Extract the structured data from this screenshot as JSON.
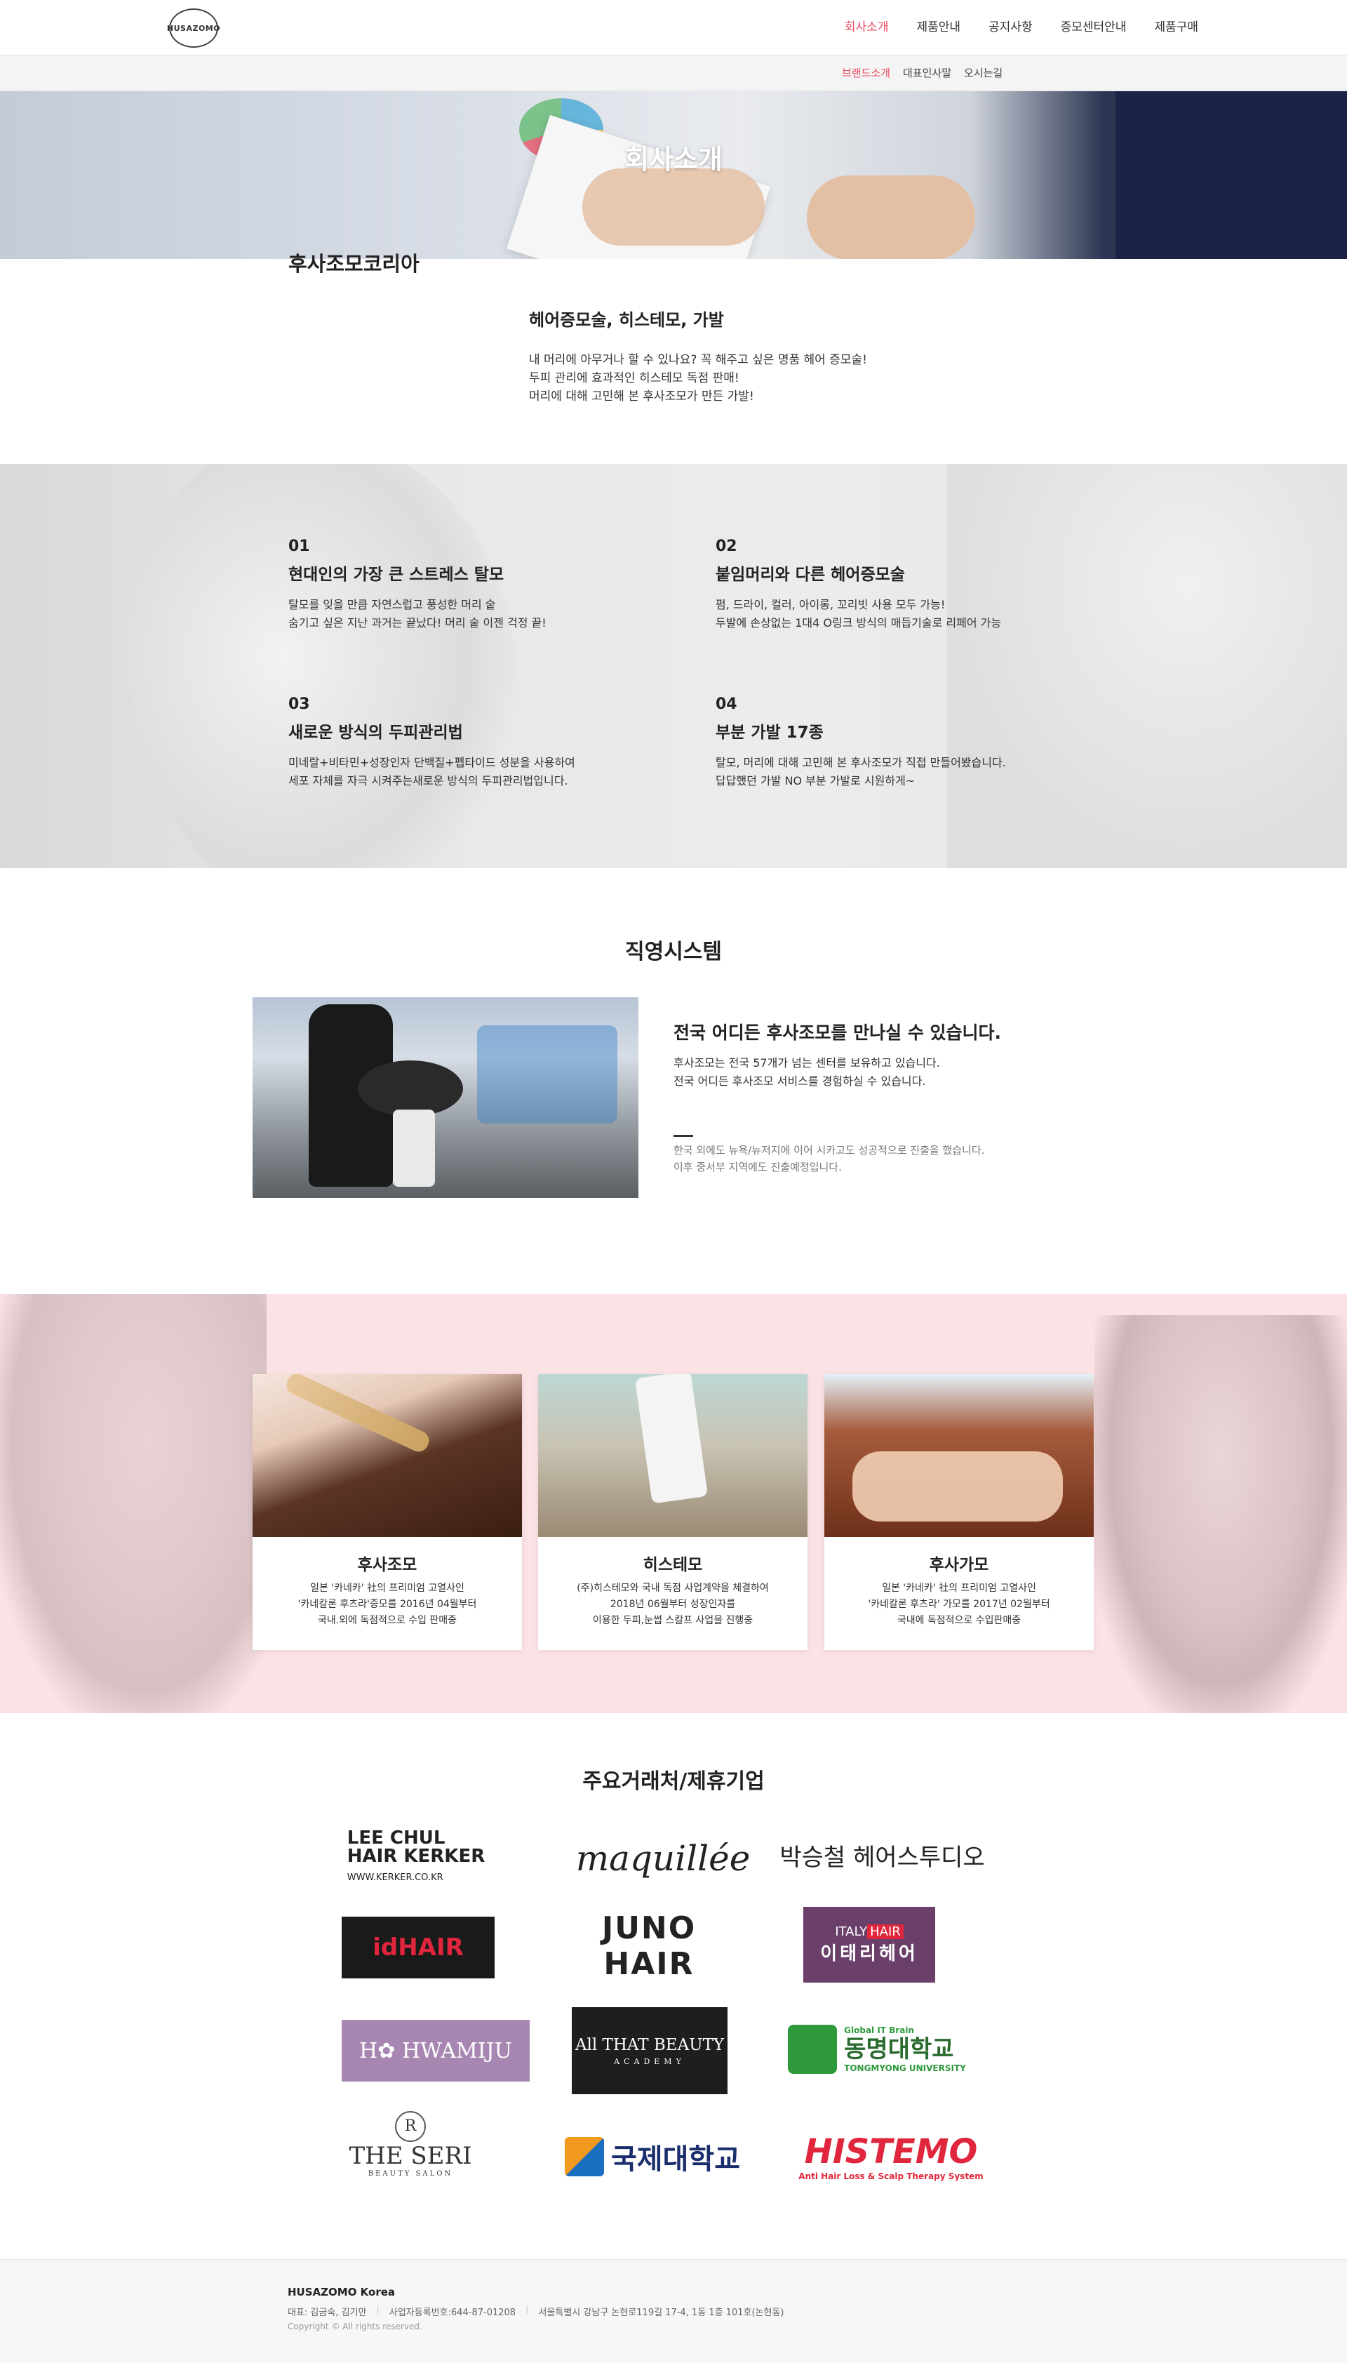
{
  "header": {
    "logo_text": "HUSAZOMO",
    "nav": [
      "회사소개",
      "제품안내",
      "공지사항",
      "증모센터안내",
      "제품구매"
    ],
    "subnav": [
      "브랜드소개",
      "대표인사말",
      "오시는길"
    ]
  },
  "hero": {
    "title": "회사소개"
  },
  "about": {
    "brand": "후사조모코리아",
    "heading": "헤어증모술, 히스테모, 가발",
    "lines": [
      "내 머리에 아무거나 할 수 있나요? 꼭 해주고 싶은 명품 헤어 증모술!",
      "두피 관리에 효과적인 히스테모 독점 판매!",
      "머리에 대해 고민해 본 후사조모가 만든 가발!"
    ]
  },
  "features": [
    {
      "num": "01",
      "title": "현대인의 가장 큰 스트레스 탈모",
      "lines": [
        "탈모를 잊을 만큼 자연스럽고 풍성한 머리 숱",
        "숨기고 싶은 지난 과거는 끝났다! 머리 숱 이젠 걱정 끝!"
      ]
    },
    {
      "num": "02",
      "title": "붙임머리와 다른 헤어증모술",
      "lines": [
        "펌, 드라이, 컬러, 아이롱, 꼬리빗 사용 모두 가능!",
        "두발에 손상없는 1대4 O링크 방식의 매듭기술로 리페어 가능"
      ]
    },
    {
      "num": "03",
      "title": "새로운 방식의 두피관리법",
      "lines": [
        "미네랄+비타민+성장인자 단백질+펩타이드 성분을 사용하여",
        "세포 자체를 자극 시켜주는새로운 방식의 두피관리법입니다."
      ]
    },
    {
      "num": "04",
      "title": "부분 가발 17종",
      "lines": [
        "탈모, 머리에 대해 고민해 본 후사조모가 직접 만들어봤습니다.",
        "답답했던 가발 NO 부분 가발로 시원하게~"
      ]
    }
  ],
  "system": {
    "title": "직영시스템",
    "heading": "전국 어디든 후사조모를 만나실 수 있습니다.",
    "lines": [
      "후사조모는 전국 57개가 넘는 센터를 보유하고 있습니다.",
      "전국 어디든 후사조모 서비스를 경험하실 수 있습니다."
    ],
    "note": [
      "한국 외에도 뉴욕/뉴저지에 이어 시카고도 성공적으로 진출을 했습니다.",
      "이후 중서부 지역에도 진출예정입니다."
    ]
  },
  "products": [
    {
      "title": "후사조모",
      "lines": [
        "일본 '카네카' 社의 프리미엄 고열사인",
        "'카네칼론 후츠라'증모를 2016년 04월부터",
        "국내.외에 독점적으로 수입 판매중"
      ]
    },
    {
      "title": "히스테모",
      "lines": [
        "(주)히스테모와 국내 독점 사업계약을 체결하여",
        "2018년 06월부터 성장인자를",
        "이용한 두피,눈썹 스칼프 사업을 진행중"
      ]
    },
    {
      "title": "후사가모",
      "lines": [
        "일본 '카네카' 社의 프리미엄 고열사인",
        "'카네칼론 후츠라' 가모를 2017년 02월부터",
        "국내에 독점적으로 수입판매중"
      ]
    }
  ],
  "partners": {
    "title": "주요거래처/제휴기업",
    "logos": {
      "kerker_top": "LEE CHUL",
      "kerker_mid": "HAIR KERKER",
      "kerker_url": "WWW.KERKER.CO.KR",
      "maquillee": "maquillée",
      "park": "박승철 헤어스투디오",
      "idhair_a": "id",
      "idhair_b": "HAIR",
      "juno": "JUNO HAIR",
      "italy_top_a": "ITALY",
      "italy_top_b": "HAIR",
      "italy_kr": "이태리헤어",
      "hwamiju": "H✿ HWAMIJU",
      "allthat": "All THAT BEAUTY",
      "allthat_sub": "ACADEMY",
      "tong_sub": "Global IT Brain",
      "tong_kr": "동명대학교",
      "tong_en": "TONGMYONG UNIVERSITY",
      "seri_mark": "R",
      "seri": "THE SERI",
      "seri_sub": "BEAUTY SALON",
      "kukje": "국제대학교",
      "histemo": "HISTEMO",
      "histemo_sub": "Anti Hair Loss & Scalp Therapy System"
    }
  },
  "footer": {
    "company": "HUSAZOMO Korea",
    "ceo": "대표: 김금숙, 김기만",
    "biz": "사업자등록번호:644-87-01208",
    "addr": "서울특별시 강남구 논현로119길 17-4, 1동 1층 101호(논현동)",
    "copyright": "Copyright © All rights reserved."
  }
}
